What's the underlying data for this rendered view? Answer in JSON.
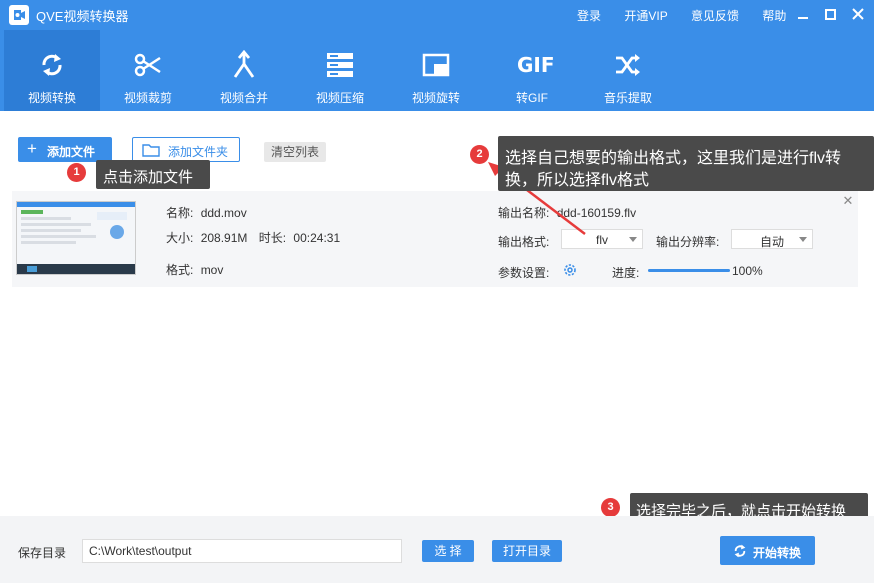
{
  "app": {
    "title": "QVE视频转换器"
  },
  "topbar": {
    "login": "登录",
    "vip": "开通VIP",
    "feedback": "意见反馈",
    "help": "帮助"
  },
  "tools": [
    {
      "label": "视频转换",
      "icon": "refresh-icon",
      "active": true
    },
    {
      "label": "视频裁剪",
      "icon": "scissors-icon"
    },
    {
      "label": "视频合并",
      "icon": "merge-icon"
    },
    {
      "label": "视频压缩",
      "icon": "compress-icon"
    },
    {
      "label": "视频旋转",
      "icon": "rotate-icon"
    },
    {
      "label": "转GIF",
      "icon": "gif-icon"
    },
    {
      "label": "音乐提取",
      "icon": "shuffle-icon"
    }
  ],
  "gif_text": "GIF",
  "actions": {
    "add_file": "添加文件",
    "add_folder": "添加文件夹",
    "clear_list": "清空列表"
  },
  "file": {
    "name_label": "名称:",
    "name": "ddd.mov",
    "size_label": "大小:",
    "size": "208.91M",
    "duration_label": "时长:",
    "duration": "00:24:31",
    "format_label": "格式:",
    "format": "mov",
    "output_name_label": "输出名称:",
    "output_name": "ddd-160159.flv",
    "output_format_label": "输出格式:",
    "output_format": "flv",
    "resolution_label": "输出分辨率:",
    "resolution": "自动",
    "params_label": "参数设置:",
    "progress_label": "进度:",
    "progress": "100%",
    "progress_value": 1.0
  },
  "callouts": [
    {
      "number": "1",
      "text": "点击添加文件"
    },
    {
      "number": "2",
      "text_line1": "选择自己想要的输出格式，这里我们是进行flv转",
      "text_line2": "换，所以选择flv格式"
    },
    {
      "number": "3",
      "text": "选择完毕之后，就点击开始转换"
    }
  ],
  "bottom": {
    "save_label": "保存目录",
    "path": "C:\\Work\\test\\output",
    "choose": "选 择",
    "open_dir": "打开目录",
    "start": "开始转换"
  },
  "colors": {
    "primary": "#3a8ee8",
    "active_tab": "#2d7dd6",
    "badge": "#e63b3b",
    "callout": "#4a4a4a"
  }
}
